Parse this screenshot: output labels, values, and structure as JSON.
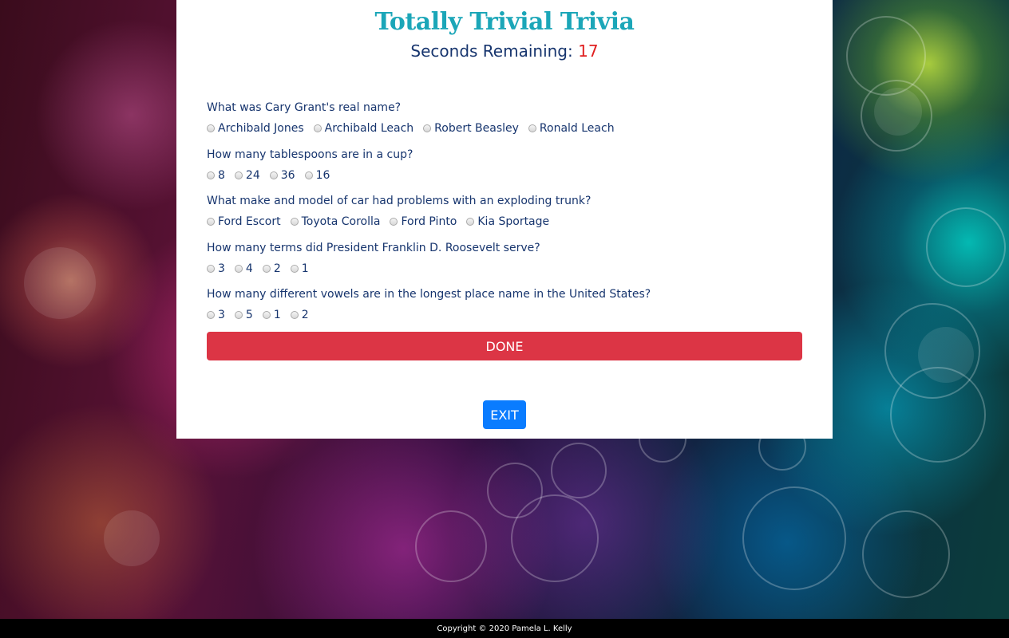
{
  "header": {
    "title": "Totally Trivial Trivia",
    "timer_label": "Seconds Remaining:",
    "timer_value": "17"
  },
  "questions": [
    {
      "text": "What was Cary Grant's real name?",
      "answers": [
        "Archibald Jones",
        "Archibald Leach",
        "Robert Beasley",
        "Ronald Leach"
      ]
    },
    {
      "text": "How many tablespoons are in a cup?",
      "answers": [
        "8",
        "24",
        "36",
        "16"
      ]
    },
    {
      "text": "What make and model of car had problems with an exploding trunk?",
      "answers": [
        "Ford Escort",
        "Toyota Corolla",
        "Ford Pinto",
        "Kia Sportage"
      ]
    },
    {
      "text": "How many terms did President Franklin D. Roosevelt serve?",
      "answers": [
        "3",
        "4",
        "2",
        "1"
      ]
    },
    {
      "text": "How many different vowels are in the longest place name in the United States?",
      "answers": [
        "3",
        "5",
        "1",
        "2"
      ]
    }
  ],
  "buttons": {
    "done_label": "DONE",
    "exit_label": "EXIT"
  },
  "footer": {
    "copyright": "Copyright © 2020 Pamela L. Kelly"
  },
  "colors": {
    "title": "#1ba6b8",
    "text": "#17356e",
    "timer_value": "#e02020",
    "done_button": "#dc3545",
    "exit_button": "#0a7cff"
  }
}
